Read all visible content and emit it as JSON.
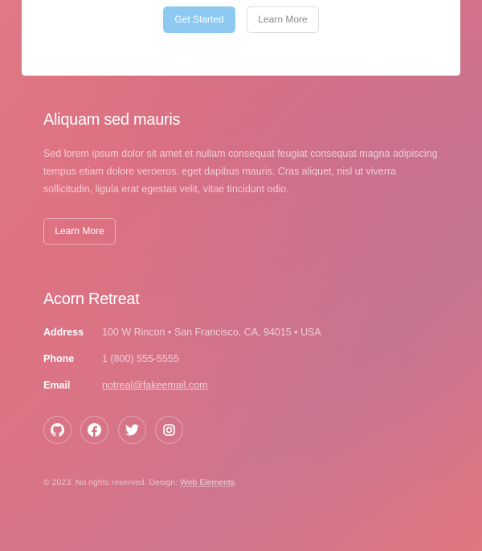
{
  "intro_card": {
    "primary_button": "Get Started",
    "secondary_button": "Learn More"
  },
  "section": {
    "title": "Aliquam sed mauris",
    "body": "Sed lorem ipsum dolor sit amet et nullam consequat feugiat consequat magna adipiscing tempus etiam dolore veroeros. eget dapibus mauris. Cras aliquet, nisl ut viverra sollicitudin, ligula erat egestas velit, vitae tincidunt odio.",
    "button": "Learn More"
  },
  "contact": {
    "title": "Acorn Retreat",
    "rows": [
      {
        "label": "Address",
        "value": "100 W Rincon • San Francisco, CA, 94015 • USA"
      },
      {
        "label": "Phone",
        "value": "1 (800) 555-5555"
      },
      {
        "label": "Email",
        "value": "notreal@fakeemail.com"
      }
    ],
    "social_icons": [
      "github-icon",
      "facebook-icon",
      "twitter-icon",
      "instagram-icon"
    ]
  },
  "footer": {
    "text": "© 2023. No rights reserved. Design:",
    "credit": "Web Elements",
    "period": "."
  },
  "colors": {
    "background_start": "#e07886",
    "background_end": "#c87590",
    "primary_button": "#8ec9f2",
    "card": "#ffffff"
  }
}
